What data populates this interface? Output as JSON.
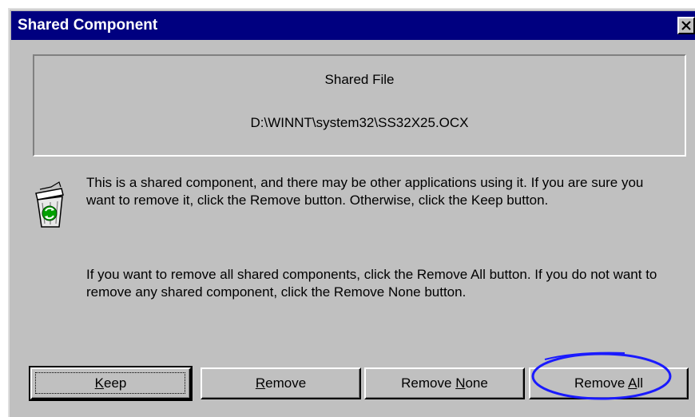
{
  "window": {
    "title": "Shared Component",
    "close_label": "×"
  },
  "file_info": {
    "heading": "Shared File",
    "path": "D:\\WINNT\\system32\\SS32X25.OCX"
  },
  "messages": {
    "warning": "This is a shared component, and there may be other applications using it.  If you are sure you want to remove it, click the Remove button.  Otherwise, click the Keep button.",
    "remove_all_info": "If you want to remove all shared components, click the Remove All button.  If you do not want to remove any shared component, click the Remove None button."
  },
  "buttons": {
    "keep": {
      "mnemonic": "K",
      "rest": "eep"
    },
    "remove": {
      "mnemonic": "R",
      "rest": "emove"
    },
    "remove_none": {
      "prefix": "Remove ",
      "mnemonic": "N",
      "rest": "one"
    },
    "remove_all": {
      "prefix": "Remove ",
      "mnemonic": "A",
      "rest": "ll"
    }
  },
  "icons": {
    "dialog_icon": "recycle-bin-icon"
  },
  "colors": {
    "titlebar": "#000080",
    "face": "#c0c0c0",
    "highlight_annotation": "#1a1aff"
  }
}
